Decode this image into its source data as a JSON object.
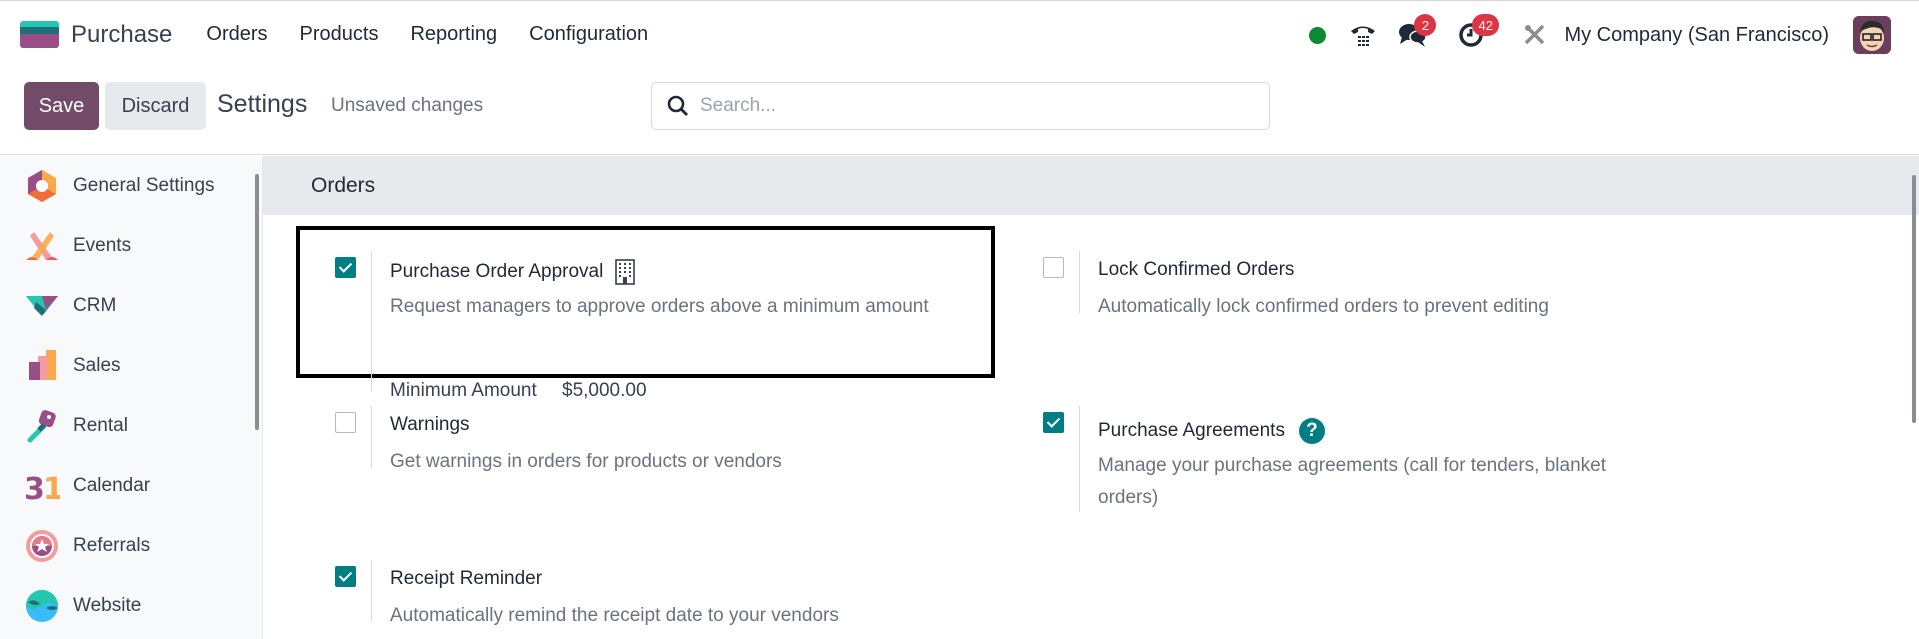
{
  "navbar": {
    "app_name": "Purchase",
    "menu": [
      "Orders",
      "Products",
      "Reporting",
      "Configuration"
    ],
    "systray": {
      "presence_status": "online",
      "messages_badge": "2",
      "activities_badge": "42",
      "company": "My Company (San Francisco)"
    }
  },
  "controlbar": {
    "save_label": "Save",
    "discard_label": "Discard",
    "page_title": "Settings",
    "status": "Unsaved changes",
    "search_placeholder": "Search..."
  },
  "sidebar": {
    "items": [
      {
        "label": "General Settings",
        "icon": "general-settings-icon"
      },
      {
        "label": "Events",
        "icon": "events-icon"
      },
      {
        "label": "CRM",
        "icon": "crm-icon"
      },
      {
        "label": "Sales",
        "icon": "sales-icon"
      },
      {
        "label": "Rental",
        "icon": "rental-icon"
      },
      {
        "label": "Calendar",
        "icon": "calendar-icon"
      },
      {
        "label": "Referrals",
        "icon": "referrals-icon"
      },
      {
        "label": "Website",
        "icon": "website-icon"
      }
    ]
  },
  "section": {
    "title": "Orders",
    "settings": [
      {
        "title": "Purchase Order Approval",
        "description": "Request managers to approve orders above a minimum amount",
        "checked": true,
        "extra_label": "Minimum Amount",
        "extra_value": "$5,000.00"
      },
      {
        "title": "Lock Confirmed Orders",
        "description": "Automatically lock confirmed orders to prevent editing",
        "checked": false
      },
      {
        "title": "Warnings",
        "description": "Get warnings in orders for products or vendors",
        "checked": false
      },
      {
        "title": "Purchase Agreements",
        "description": "Manage your purchase agreements (call for tenders, blanket orders)",
        "checked": true
      },
      {
        "title": "Receipt Reminder",
        "description": "Automatically remind the receipt date to your vendors",
        "checked": true
      }
    ]
  },
  "colors": {
    "primary": "#714b67",
    "accent": "#017e84",
    "badge": "#dc3545",
    "presence": "#0d8a2e"
  }
}
